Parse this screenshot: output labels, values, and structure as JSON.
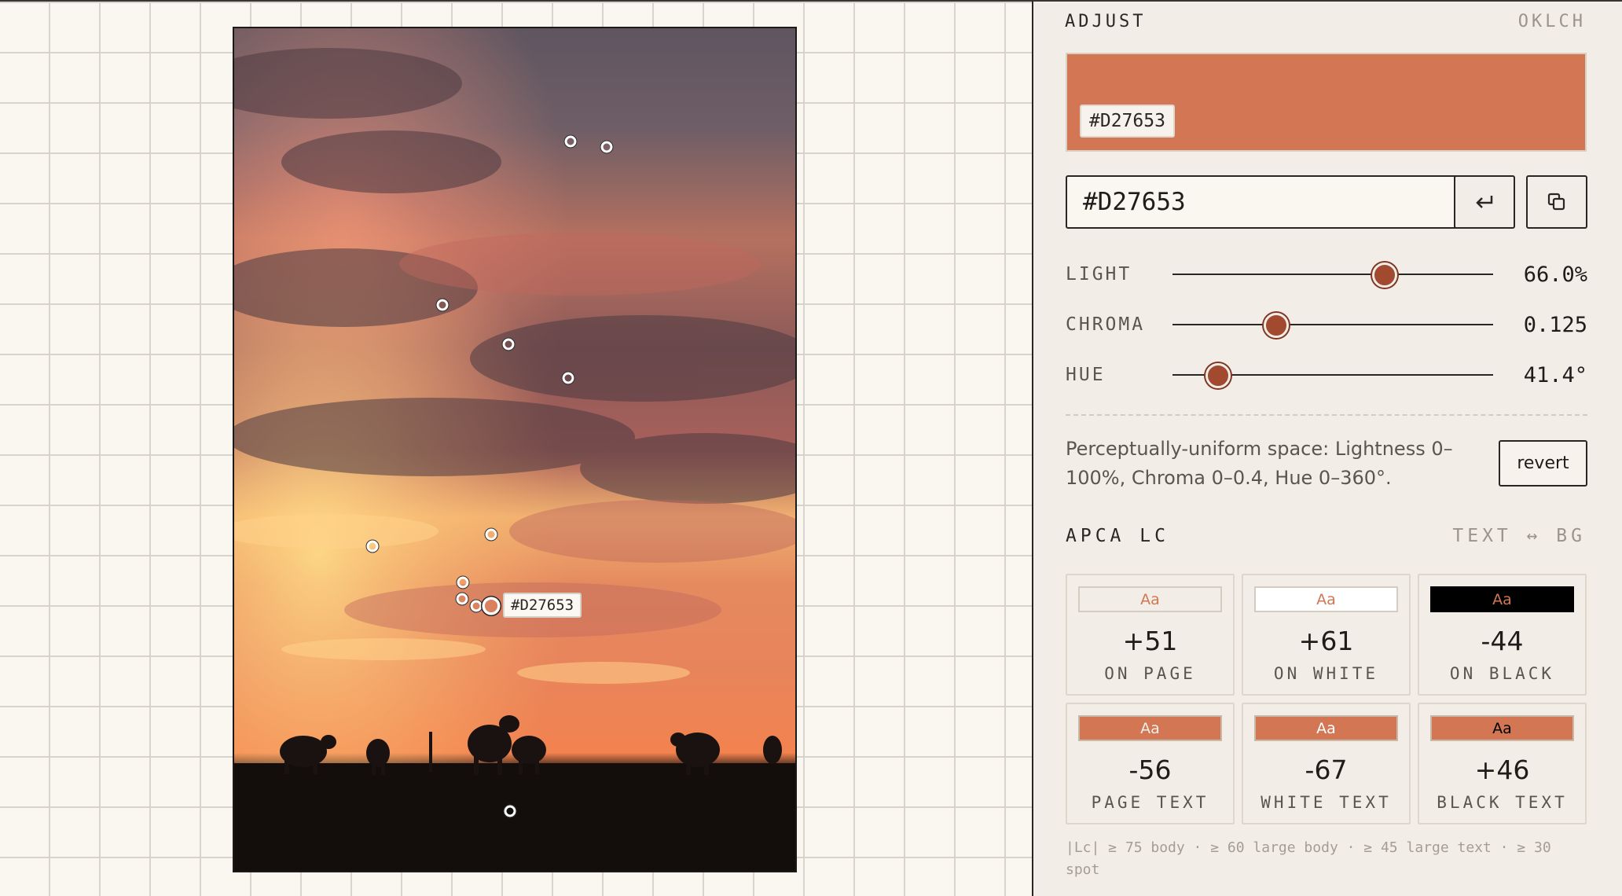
{
  "canvas": {
    "sample_tag": "#D27653"
  },
  "panel": {
    "title": "ADJUST",
    "space": "OKLCH",
    "swatch_color": "#D27653",
    "swatch_label": "#D27653",
    "hex_value": "#D27653",
    "sliders": [
      {
        "label": "LIGHT",
        "value": "66.0%",
        "fraction": 0.66
      },
      {
        "label": "CHROMA",
        "value": "0.125",
        "fraction": 0.32
      },
      {
        "label": "HUE",
        "value": "41.4°",
        "fraction": 0.14
      }
    ],
    "note": "Perceptually-uniform space: Lightness 0–100%, Chroma 0–0.4, Hue 0–360°.",
    "revert_label": "revert",
    "apca": {
      "title": "APCA LC",
      "subtitle": "TEXT ↔ BG",
      "cells": [
        {
          "sample": "Aa",
          "value": "+51",
          "caption": "ON PAGE"
        },
        {
          "sample": "Aa",
          "value": "+61",
          "caption": "ON WHITE"
        },
        {
          "sample": "Aa",
          "value": "-44",
          "caption": "ON BLACK"
        },
        {
          "sample": "Aa",
          "value": "-56",
          "caption": "PAGE TEXT"
        },
        {
          "sample": "Aa",
          "value": "-67",
          "caption": "WHITE TEXT"
        },
        {
          "sample": "Aa",
          "value": "+46",
          "caption": "BLACK TEXT"
        }
      ],
      "footnote": "|Lc| ≥ 75 body · ≥ 60 large body · ≥ 45 large text · ≥ 30 spot"
    }
  }
}
